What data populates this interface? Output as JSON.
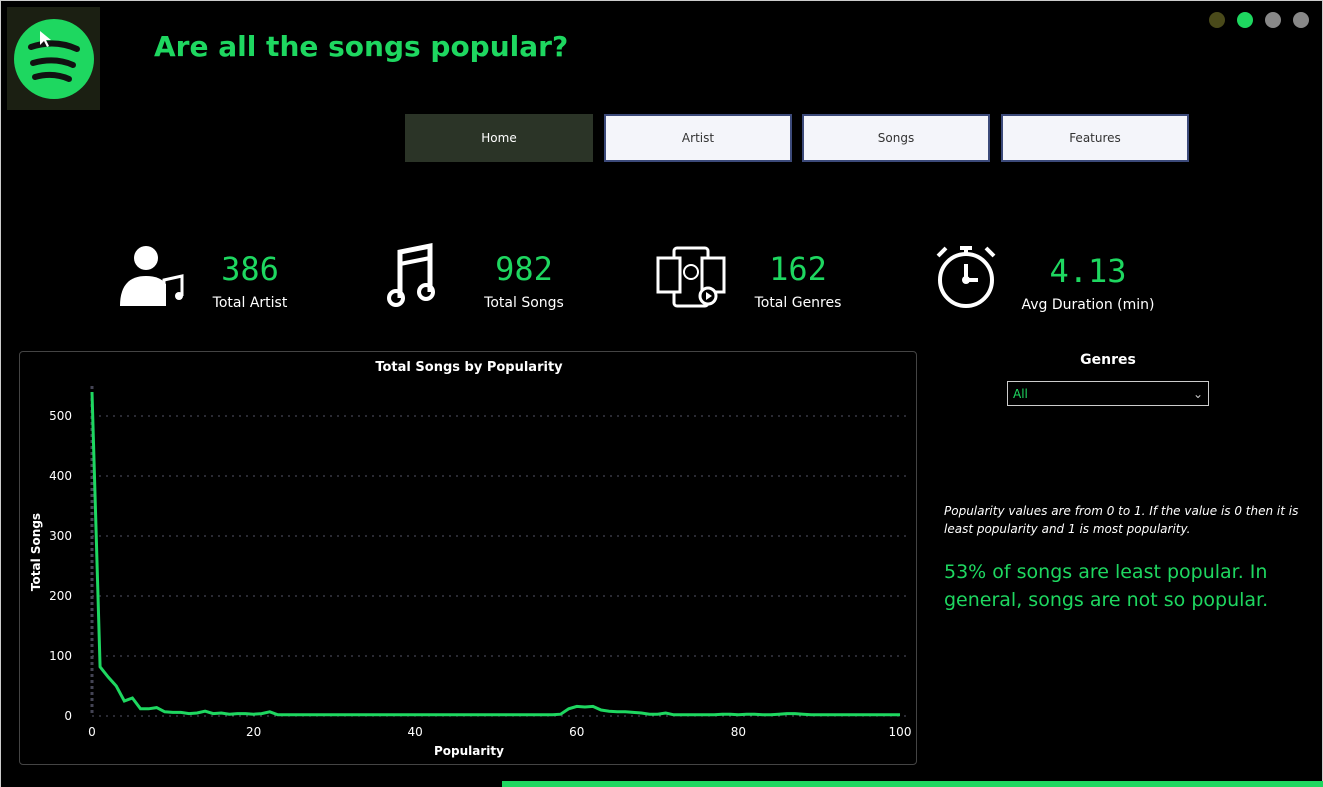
{
  "header": {
    "title": "Are all the songs popular?"
  },
  "nav": [
    {
      "label": "Home",
      "active": true
    },
    {
      "label": "Artist"
    },
    {
      "label": "Songs"
    },
    {
      "label": "Features"
    }
  ],
  "kpis": [
    {
      "value": "386",
      "label": "Total Artist",
      "icon": "artist-music-icon"
    },
    {
      "value": "982",
      "label": "Total Songs",
      "icon": "music-note-icon"
    },
    {
      "value": "162",
      "label": "Total Genres",
      "icon": "genres-icon"
    },
    {
      "value": "4.13",
      "label": "Avg Duration (min)",
      "icon": "stopwatch-icon"
    }
  ],
  "filter": {
    "label": "Genres",
    "value": "All"
  },
  "note": "Popularity values are from 0 to 1. If the value is 0 then it is least popularity and 1 is most popularity.",
  "insight": " 53% of songs are least popular. In general, songs are not so popular.",
  "colors": {
    "accent": "#1ed760"
  },
  "chart_data": {
    "type": "line",
    "title": "Total Songs by Popularity",
    "xlabel": "Popularity",
    "ylabel": "Total Songs",
    "xlim": [
      0,
      100
    ],
    "ylim": [
      0,
      550
    ],
    "xticks": [
      0,
      20,
      40,
      60,
      80,
      100
    ],
    "yticks": [
      0,
      100,
      200,
      300,
      400,
      500
    ],
    "x": [
      0,
      1,
      2,
      3,
      4,
      5,
      6,
      7,
      8,
      9,
      10,
      11,
      12,
      13,
      14,
      15,
      16,
      17,
      18,
      19,
      20,
      21,
      22,
      23,
      24,
      25,
      26,
      27,
      28,
      29,
      30,
      31,
      32,
      33,
      34,
      35,
      36,
      37,
      38,
      39,
      40,
      41,
      42,
      43,
      44,
      45,
      46,
      47,
      48,
      49,
      50,
      51,
      52,
      53,
      54,
      55,
      56,
      57,
      58,
      59,
      60,
      61,
      62,
      63,
      64,
      65,
      66,
      67,
      68,
      69,
      70,
      71,
      72,
      73,
      74,
      75,
      76,
      77,
      78,
      79,
      80,
      81,
      82,
      83,
      84,
      85,
      86,
      87,
      88,
      89,
      90,
      91,
      92,
      93,
      94,
      95,
      96,
      97,
      98,
      99,
      100
    ],
    "y": [
      540,
      82,
      65,
      50,
      25,
      30,
      12,
      12,
      14,
      7,
      6,
      6,
      4,
      5,
      8,
      4,
      5,
      3,
      4,
      4,
      3,
      4,
      7,
      2,
      2,
      2,
      2,
      2,
      2,
      2,
      2,
      2,
      2,
      2,
      2,
      2,
      2,
      2,
      2,
      2,
      2,
      2,
      2,
      2,
      2,
      2,
      2,
      2,
      2,
      2,
      2,
      2,
      2,
      2,
      2,
      2,
      2,
      2,
      3,
      12,
      16,
      15,
      16,
      10,
      8,
      7,
      7,
      6,
      5,
      3,
      3,
      5,
      2,
      2,
      2,
      2,
      2,
      2,
      3,
      3,
      2,
      3,
      3,
      2,
      2,
      3,
      4,
      4,
      3,
      2,
      2,
      2,
      2,
      2,
      2,
      2,
      2,
      2,
      2,
      2,
      2
    ]
  }
}
